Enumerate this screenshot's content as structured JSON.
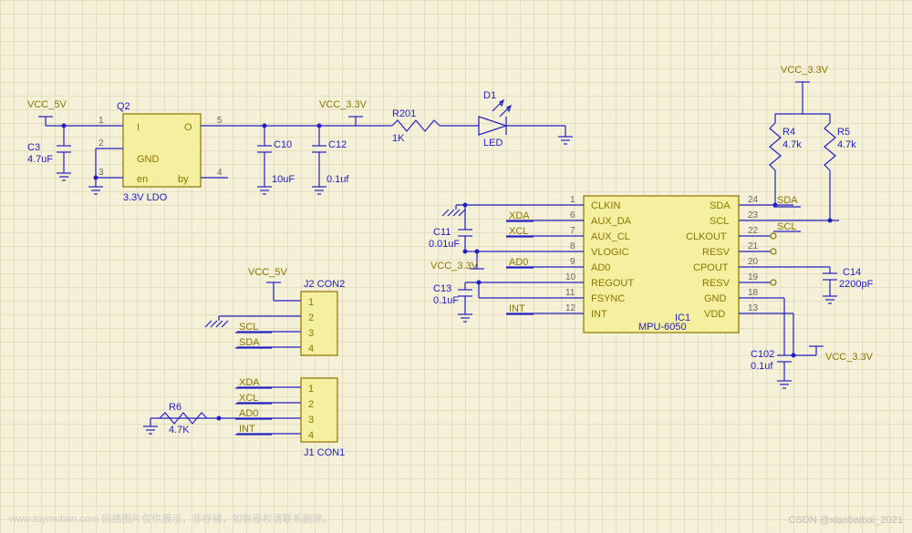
{
  "labels": {
    "vcc5_1": "VCC_5V",
    "vcc33_1": "VCC_3.3V",
    "vcc33_top": "VCC_3.3V",
    "vcc33_c11": "VCC_3.3V",
    "vcc33_bot": "VCC_3.3V",
    "q2": "Q2",
    "q2_sub": "3.3V LDO",
    "q2_i": "I",
    "q2_o": "O",
    "q2_gnd": "GND",
    "q2_en": "en",
    "q2_by": "by",
    "c3": "C3",
    "c3v": "4.7uF",
    "c10": "C10",
    "c10v": "10uF",
    "c12": "C12",
    "c12v": "0.1uf",
    "r201": "R201",
    "r201v": "1K",
    "d1": "D1",
    "led": "LED",
    "r4": "R4",
    "r4v": "4.7k",
    "r5": "R5",
    "r5v": "4.7k",
    "c11": "C11",
    "c11v": "0.01uF",
    "c13": "C13",
    "c13v": "0.1uF",
    "c14": "C14",
    "c14v": "2200pF",
    "c102": "C102",
    "c102v": "0.1uf",
    "r6": "R6",
    "r6v": "4.7K",
    "j2": "J2 CON2",
    "j1": "J1 CON1",
    "vcc5_j2": "VCC_5V",
    "sig_scl": "SCL",
    "sig_sda": "SDA",
    "sig_xda": "XDA",
    "sig_xcl": "XCL",
    "sig_ad0": "AD0",
    "sig_int": "INT",
    "sig_sda2": "SDA",
    "sig_scl2": "SCL",
    "ic1": "IC1",
    "ic1_name": "MPU-6050",
    "p_clkin": "CLKIN",
    "p_auxda": "AUX_DA",
    "p_auxcl": "AUX_CL",
    "p_vlogic": "VLOGIC",
    "p_ad0": "AD0",
    "p_regout": "REGOUT",
    "p_fsync": "FSYNC",
    "p_int": "INT",
    "p_sda": "SDA",
    "p_scl": "SCL",
    "p_clkout": "CLKOUT",
    "p_resv": "RESV",
    "p_cpout": "CPOUT",
    "p_resv2": "RESV",
    "p_gnd": "GND",
    "p_vdd": "VDD",
    "pin1": "1",
    "pin2": "2",
    "pin3": "3",
    "pin4": "4",
    "pin5": "5",
    "pin6": "6",
    "pin7": "7",
    "pin8": "8",
    "pin9": "9",
    "pin10": "10",
    "pin11": "11",
    "pin12": "12",
    "pin13": "13",
    "pin18": "18",
    "pin19": "19",
    "pin20": "20",
    "pin21": "21",
    "pin22": "22",
    "pin23": "23",
    "pin24": "24"
  },
  "watermark_left": "www.toymoban.com  网络图片仅供展示，非存储，如有侵权请联系删除。",
  "watermark_right": "CSDN @xiaobaibai_2021"
}
